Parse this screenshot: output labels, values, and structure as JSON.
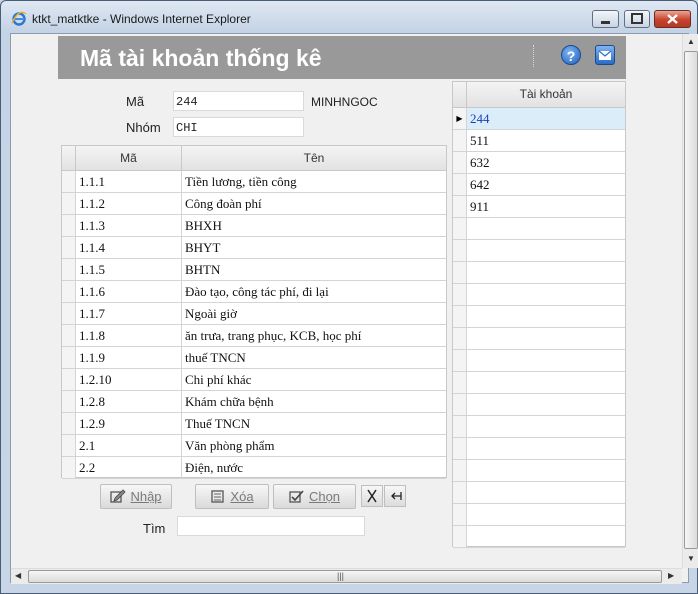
{
  "window": {
    "title": "ktkt_matktke - Windows Internet Explorer"
  },
  "header": {
    "title": "Mã tài khoản thống kê",
    "help_icon": "help-icon",
    "mail_icon": "mail-icon"
  },
  "form": {
    "ma_label": "Mã",
    "ma_value": "244",
    "user_name": "MINHNGOC",
    "nhom_label": "Nhóm",
    "nhom_value": "CHI",
    "tim_label": "Tìm",
    "tim_value": ""
  },
  "left_grid": {
    "columns": [
      "Mã",
      "Tên"
    ],
    "rows": [
      {
        "ma": "1.1.1",
        "ten": "Tiền lương, tiền công"
      },
      {
        "ma": "1.1.2",
        "ten": "Công đoàn phí"
      },
      {
        "ma": "1.1.3",
        "ten": "BHXH"
      },
      {
        "ma": "1.1.4",
        "ten": "BHYT"
      },
      {
        "ma": "1.1.5",
        "ten": "BHTN"
      },
      {
        "ma": "1.1.6",
        "ten": "Đào tạo, công tác phí, đi lại"
      },
      {
        "ma": "1.1.7",
        "ten": "Ngoài giờ"
      },
      {
        "ma": "1.1.8",
        "ten": "ăn trưa, trang phục, KCB, học phí"
      },
      {
        "ma": "1.1.9",
        "ten": "thuế TNCN"
      },
      {
        "ma": "1.2.10",
        "ten": "Chi phí khác"
      },
      {
        "ma": "1.2.8",
        "ten": "Khám chữa bệnh"
      },
      {
        "ma": "1.2.9",
        "ten": "Thuế TNCN"
      },
      {
        "ma": "2.1",
        "ten": "Văn phòng phẩm"
      },
      {
        "ma": "2.2",
        "ten": "Điện, nước"
      }
    ]
  },
  "buttons": {
    "nhap": "Nhập",
    "xoa": "Xóa",
    "chon": "Chọn",
    "cut_icon": "scissors-icon",
    "insert_icon": "insert-row-icon"
  },
  "right_grid": {
    "column": "Tài khoản",
    "rows": [
      "244",
      "511",
      "632",
      "642",
      "911"
    ],
    "selected_row": "244",
    "selected_color": "#1a3fb8"
  },
  "colors": {
    "header_band": "#999999",
    "close_button": "#c8432c"
  }
}
